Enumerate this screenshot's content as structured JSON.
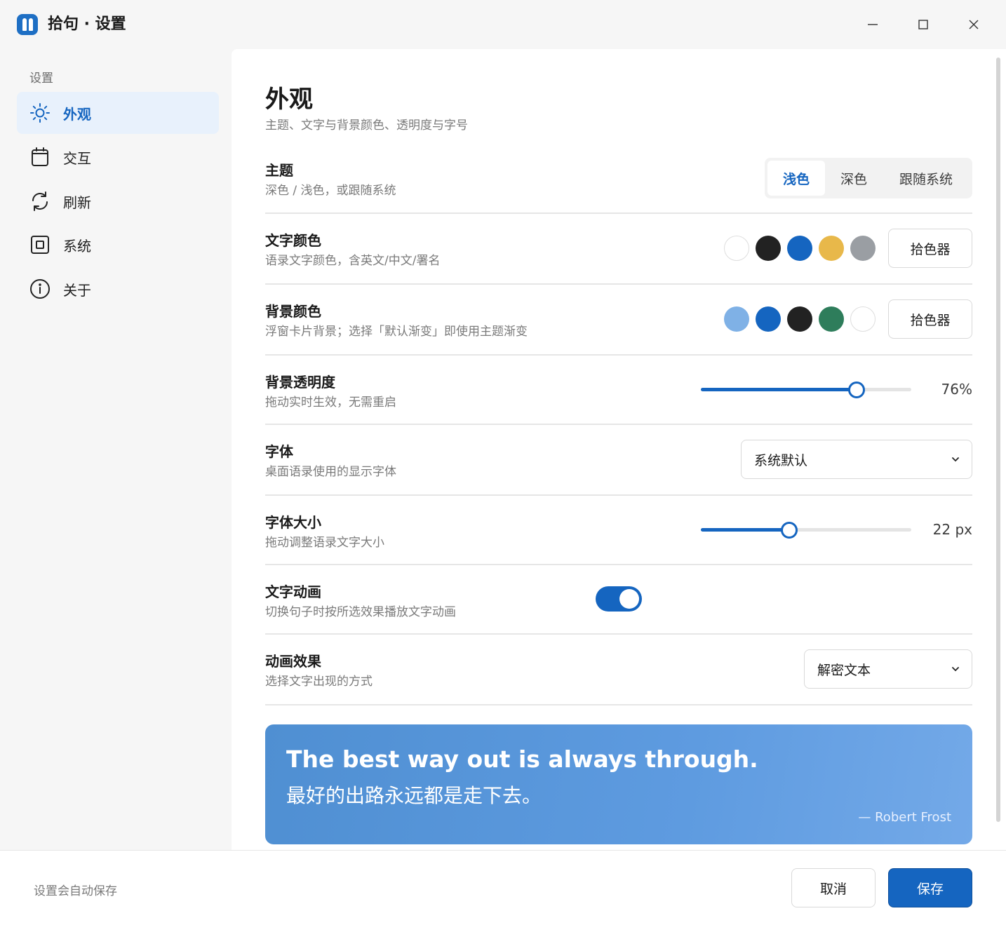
{
  "window": {
    "title": "拾句 · 设置",
    "logo_icon": "quote-logo-icon"
  },
  "sidebar": {
    "header": "设置",
    "items": [
      {
        "label": "外观",
        "icon": "sun-icon",
        "active": true
      },
      {
        "label": "交互",
        "icon": "calendar-icon",
        "active": false
      },
      {
        "label": "刷新",
        "icon": "refresh-icon",
        "active": false
      },
      {
        "label": "系统",
        "icon": "system-icon",
        "active": false
      },
      {
        "label": "关于",
        "icon": "info-icon",
        "active": false
      }
    ]
  },
  "page": {
    "title": "外观",
    "subtitle": "主题、文字与背景颜色、透明度与字号"
  },
  "theme": {
    "title": "主题",
    "desc": "深色 / 浅色，或跟随系统",
    "options": [
      "浅色",
      "深色",
      "跟随系统"
    ],
    "selected": "浅色"
  },
  "text_color": {
    "title": "文字颜色",
    "desc": "语录文字颜色，含英文/中文/署名",
    "swatches": [
      "#ffffff",
      "#222222",
      "#1565c0",
      "#e8b84a",
      "#9a9ea3"
    ],
    "picker_label": "拾色器"
  },
  "bg_color": {
    "title": "背景颜色",
    "desc": "浮窗卡片背景；选择「默认渐变」即使用主题渐变",
    "swatches": [
      "#7fb1e6",
      "#1565c0",
      "#222222",
      "#2e7d5b",
      "#ffffff"
    ],
    "picker_label": "拾色器"
  },
  "opacity": {
    "title": "背景透明度",
    "desc": "拖动实时生效，无需重启",
    "fraction": 0.74,
    "value_label": "76%"
  },
  "font": {
    "title": "字体",
    "desc": "桌面语录使用的显示字体",
    "selected": "系统默认"
  },
  "font_size": {
    "title": "字体大小",
    "desc": "拖动调整语录文字大小",
    "fraction": 0.42,
    "value_label": "22 px"
  },
  "text_animation": {
    "title": "文字动画",
    "desc": "切换句子时按所选效果播放文字动画",
    "enabled": true
  },
  "animation_effect": {
    "title": "动画效果",
    "desc": "选择文字出现的方式",
    "selected": "解密文本"
  },
  "preview": {
    "english": "The best way out is always through.",
    "chinese": "最好的出路永远都是走下去。",
    "author": "— Robert Frost"
  },
  "footer": {
    "hint": "设置会自动保存",
    "cancel_label": "取消",
    "save_label": "保存"
  },
  "colors": {
    "accent": "#1565c0",
    "active_nav_bg": "#e8f1fc"
  }
}
